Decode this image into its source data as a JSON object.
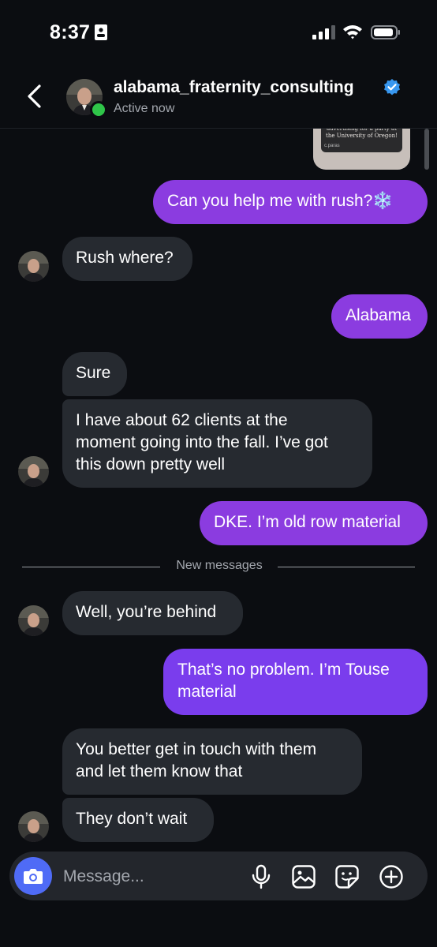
{
  "status_bar": {
    "time": "8:37"
  },
  "header": {
    "username": "alabama_fraternity_consulting",
    "status": "Active now"
  },
  "shared_post": {
    "text": "advertising for a party at the University of Oregon!",
    "sub": "c.paras"
  },
  "messages": [
    {
      "direction": "out",
      "text": "Can you help me with rush?❄️"
    },
    {
      "direction": "in",
      "text": "Rush where?"
    },
    {
      "direction": "out",
      "text": "Alabama"
    },
    {
      "direction": "in",
      "text": "Sure"
    },
    {
      "direction": "in",
      "lines": [
        "I have about 62 clients at the",
        "moment going into the fall. I’ve got",
        "this down pretty well"
      ]
    },
    {
      "direction": "out",
      "text": "DKE. I’m old row material"
    },
    {
      "direction": "in",
      "text": "Well, you’re behind"
    },
    {
      "direction": "out",
      "lines": [
        "That’s no problem. I’m Touse",
        "material"
      ]
    },
    {
      "direction": "in",
      "lines": [
        "You better get in touch with them",
        "and let them know that"
      ]
    },
    {
      "direction": "in",
      "text": "They don’t wait"
    }
  ],
  "divider": {
    "label": "New messages"
  },
  "composer": {
    "placeholder": "Message..."
  },
  "colors": {
    "background": "#0b0d11",
    "outgoing_bubble": "#8b3ce0",
    "incoming_bubble": "#262a30",
    "camera_button": "#4f6bf6",
    "online_dot": "#2fc549",
    "verified_badge": "#3897f0"
  },
  "icons": [
    "id-card-icon",
    "signal-icon",
    "wifi-icon",
    "battery-icon",
    "back-chevron-icon",
    "verified-badge-icon",
    "camera-icon",
    "microphone-icon",
    "gallery-icon",
    "sticker-icon",
    "plus-circle-icon"
  ]
}
